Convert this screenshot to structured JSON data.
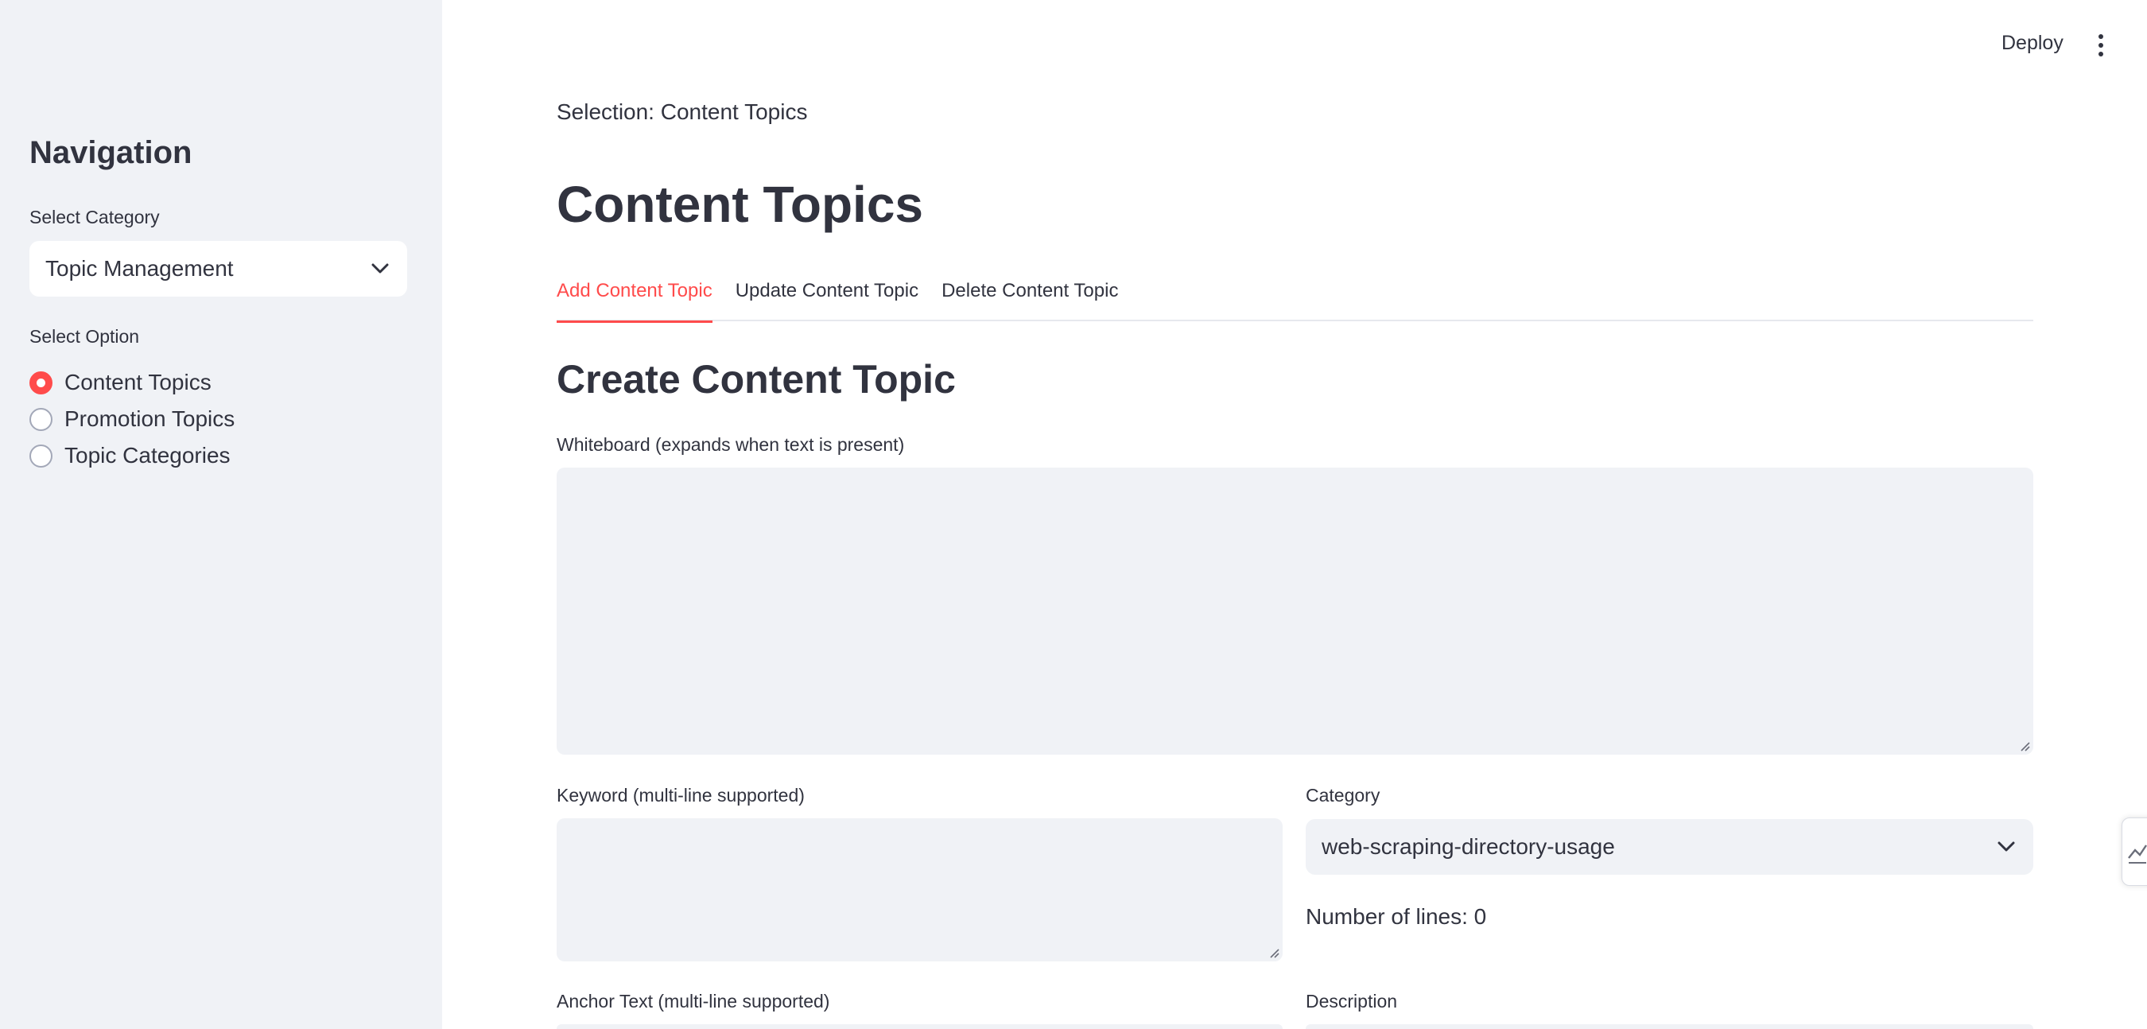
{
  "sidebar": {
    "title": "Navigation",
    "category_label": "Select Category",
    "category_value": "Topic Management",
    "option_label": "Select Option",
    "options": [
      {
        "label": "Content Topics",
        "selected": true
      },
      {
        "label": "Promotion Topics",
        "selected": false
      },
      {
        "label": "Topic Categories",
        "selected": false
      }
    ]
  },
  "header": {
    "deploy_label": "Deploy",
    "menu_icon": "kebab-menu-icon"
  },
  "main": {
    "selection_text": "Selection: Content Topics",
    "title": "Content Topics",
    "tabs": [
      {
        "label": "Add Content Topic",
        "active": true
      },
      {
        "label": "Update Content Topic",
        "active": false
      },
      {
        "label": "Delete Content Topic",
        "active": false
      }
    ],
    "section_title": "Create Content Topic",
    "whiteboard_label": "Whiteboard (expands when text is present)",
    "whiteboard_value": "",
    "keyword_label": "Keyword (multi-line supported)",
    "keyword_value": "",
    "category_label": "Category",
    "category_value": "web-scraping-directory-usage",
    "lines_text": "Number of lines: 0",
    "anchor_label": "Anchor Text (multi-line supported)",
    "description_label": "Description"
  },
  "colors": {
    "accent": "#ff4b4b",
    "sidebar_bg": "#f0f2f6",
    "text": "#31333f",
    "input_bg": "#f0f2f6"
  }
}
